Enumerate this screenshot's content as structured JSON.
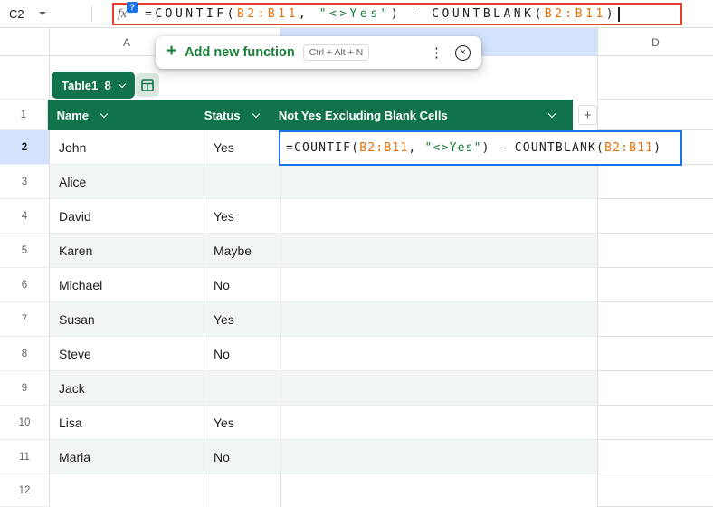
{
  "colors": {
    "table_green": "#11734b",
    "band_green": "#f2f6f3",
    "selection_blue": "#1a73e8",
    "annotation_red": "#e53d2e",
    "header_highlight_blue": "#d3e3fd",
    "link_green": "#188038",
    "range_orange": "#e8710a",
    "text_dark": "#202124",
    "muted_gray": "#5f6368",
    "grid_line": "#e0e0e0"
  },
  "name_box": {
    "value": "C2"
  },
  "formula": {
    "fx_label": "fx",
    "fx_badge": "?",
    "segments": [
      {
        "text": "=COUNTIF(",
        "color": "#202124"
      },
      {
        "text": "B2:B11",
        "color": "#e8710a"
      },
      {
        "text": ", ",
        "color": "#202124"
      },
      {
        "text": "\"<>Yes\"",
        "color": "#188038"
      },
      {
        "text": ") - COUNTBLANK(",
        "color": "#202124"
      },
      {
        "text": "B2:B11",
        "color": "#e8710a"
      },
      {
        "text": ")",
        "color": "#202124"
      }
    ]
  },
  "popup": {
    "label": "Add new function",
    "shortcut": "Ctrl + Alt + N"
  },
  "icons": {
    "plus": "+",
    "more": "⋮",
    "close": "×"
  },
  "column_headers": {
    "a": "A",
    "d": "D"
  },
  "table": {
    "name": "Table1_8",
    "header_row_num": "1",
    "headers": [
      {
        "label": "Name"
      },
      {
        "label": "Status"
      },
      {
        "label": "Not Yes Excluding Blank Cells"
      }
    ],
    "add_column_label": "+",
    "rows": [
      {
        "num": "2",
        "name": "John",
        "status": "Yes"
      },
      {
        "num": "3",
        "name": "Alice",
        "status": ""
      },
      {
        "num": "4",
        "name": "David",
        "status": "Yes"
      },
      {
        "num": "5",
        "name": "Karen",
        "status": "Maybe"
      },
      {
        "num": "6",
        "name": "Michael",
        "status": "No"
      },
      {
        "num": "7",
        "name": "Susan",
        "status": "Yes"
      },
      {
        "num": "8",
        "name": "Steve",
        "status": "No"
      },
      {
        "num": "9",
        "name": "Jack",
        "status": ""
      },
      {
        "num": "10",
        "name": "Lisa",
        "status": "Yes"
      },
      {
        "num": "11",
        "name": "Maria",
        "status": "No"
      }
    ],
    "trailing_row_num": "12"
  }
}
